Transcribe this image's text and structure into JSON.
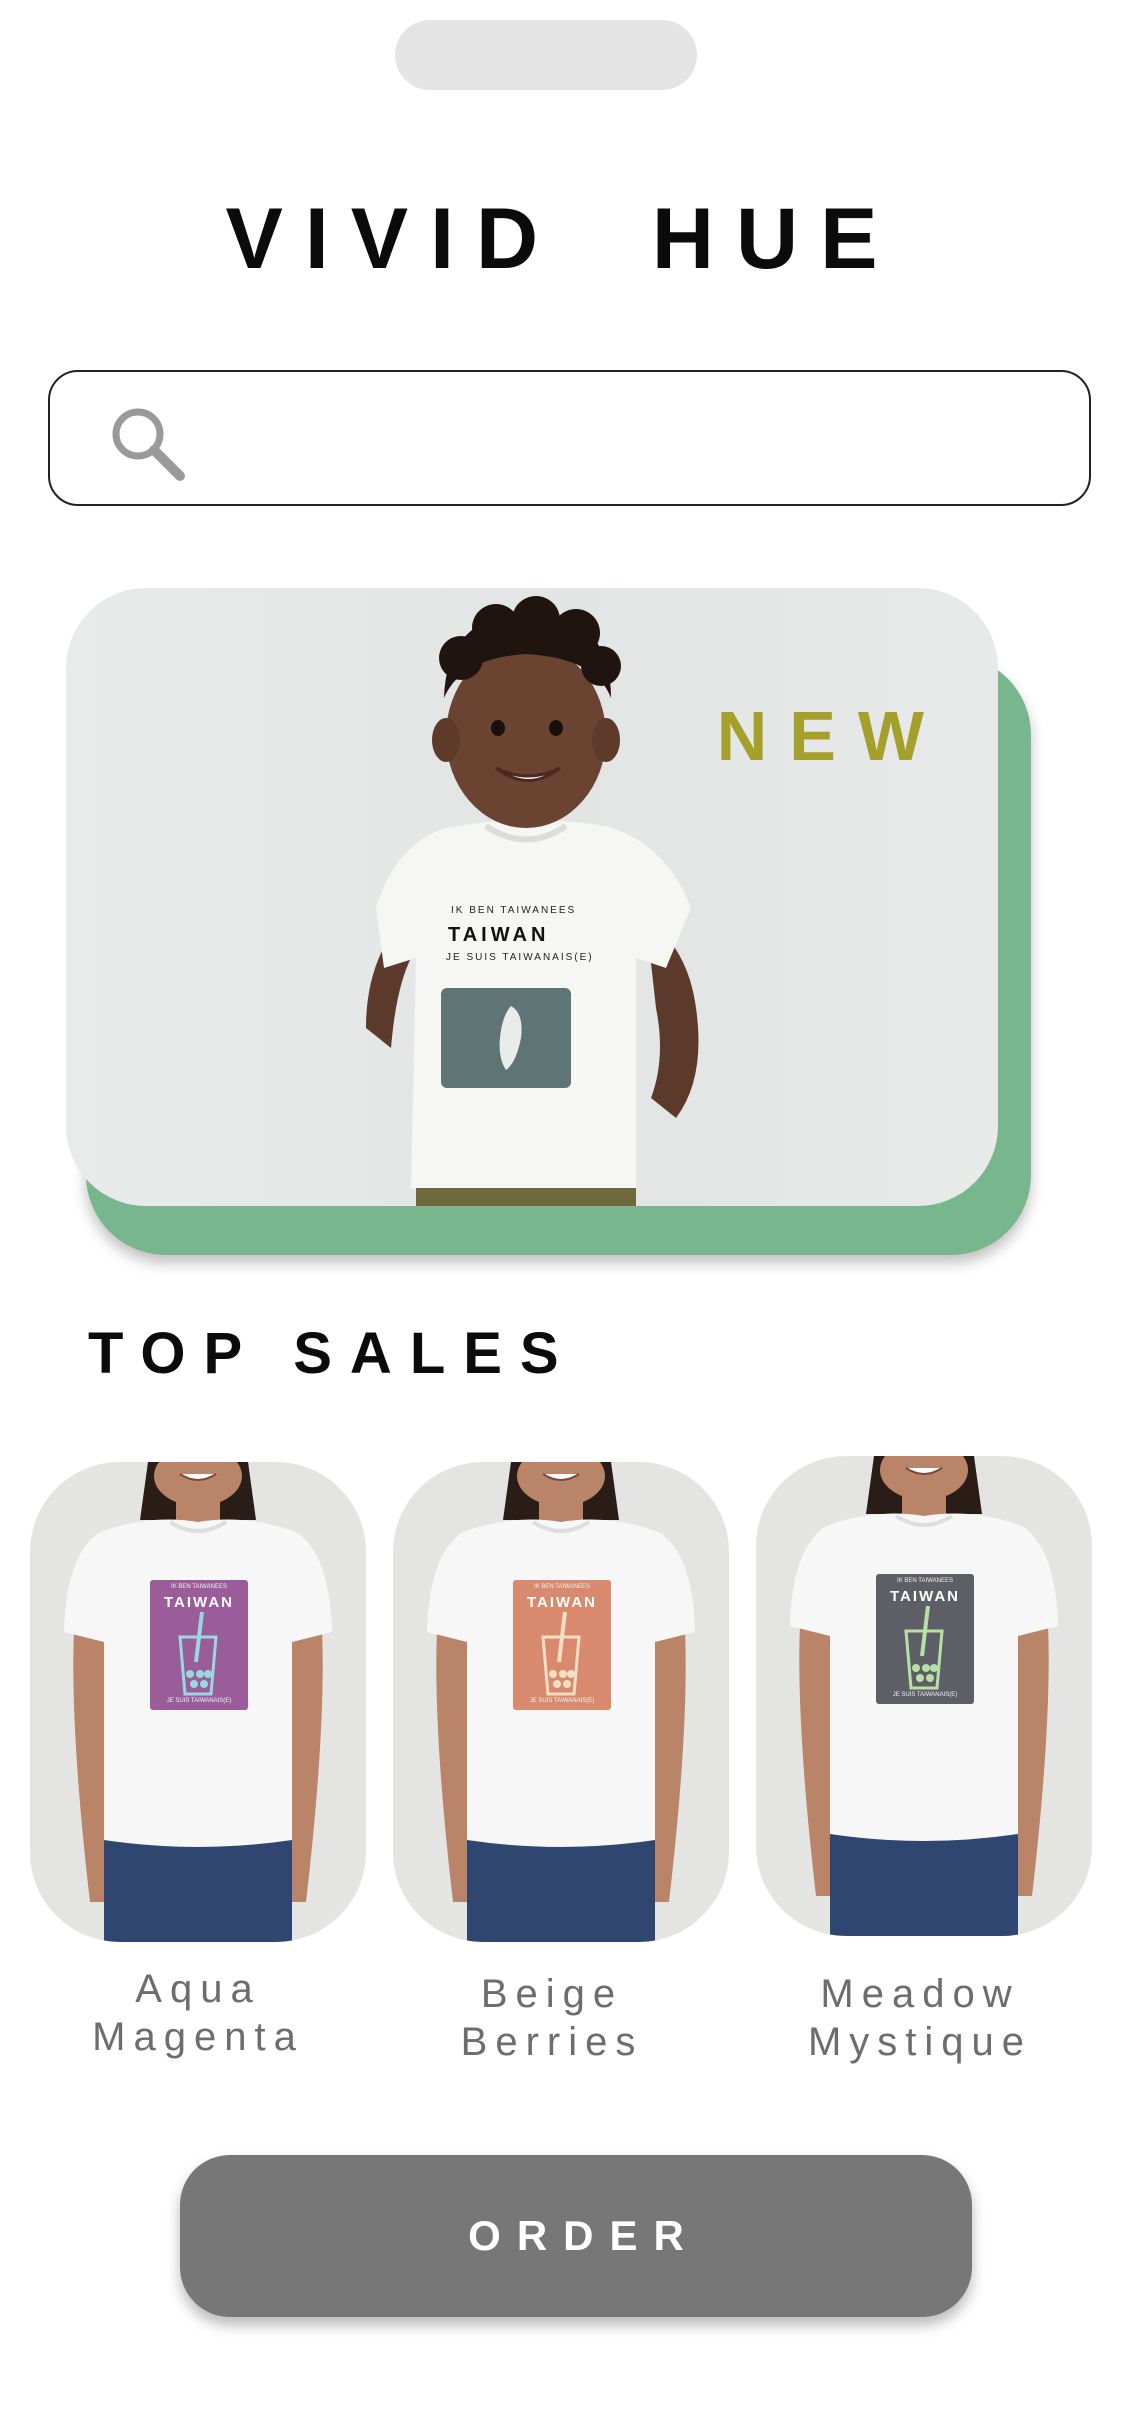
{
  "brand": {
    "title": "VIVID  HUE"
  },
  "search": {
    "value": "",
    "icon": "search-icon"
  },
  "hero": {
    "badge": "NEW",
    "accent_color": "#78b68d",
    "badge_color": "#a4a02b",
    "shirt": {
      "line1": "IK BEN TAIWANEES",
      "line2": "TAIWAN",
      "line3": "JE SUIS TAIWANAIS(E)",
      "patch_color": "#5f7475"
    }
  },
  "top_sales": {
    "title": "TOP SALES",
    "products": [
      {
        "name_line1": "Aqua",
        "name_line2": "Magenta",
        "patch_color": "#9a5d9a",
        "drink_color": "#9ad7df",
        "print_top": "IK BEN TAIWANEES",
        "print_title": "TAIWAN",
        "print_bottom": "JE SUIS TAIWANAIS(E)"
      },
      {
        "name_line1": "Beige",
        "name_line2": "Berries",
        "patch_color": "#d98a6e",
        "drink_color": "#f4dfc4",
        "print_top": "IK BEN TAIWANEES",
        "print_title": "TAIWAN",
        "print_bottom": "JE SUIS TAIWANAIS(E)"
      },
      {
        "name_line1": "Meadow",
        "name_line2": "Mystique",
        "patch_color": "#5e5e66",
        "drink_color": "#b7e0a6",
        "print_top": "IK BEN TAIWANEES",
        "print_title": "TAIWAN",
        "print_bottom": "JE SUIS TAIWANAIS(E)"
      }
    ]
  },
  "order": {
    "label": "ORDER"
  }
}
